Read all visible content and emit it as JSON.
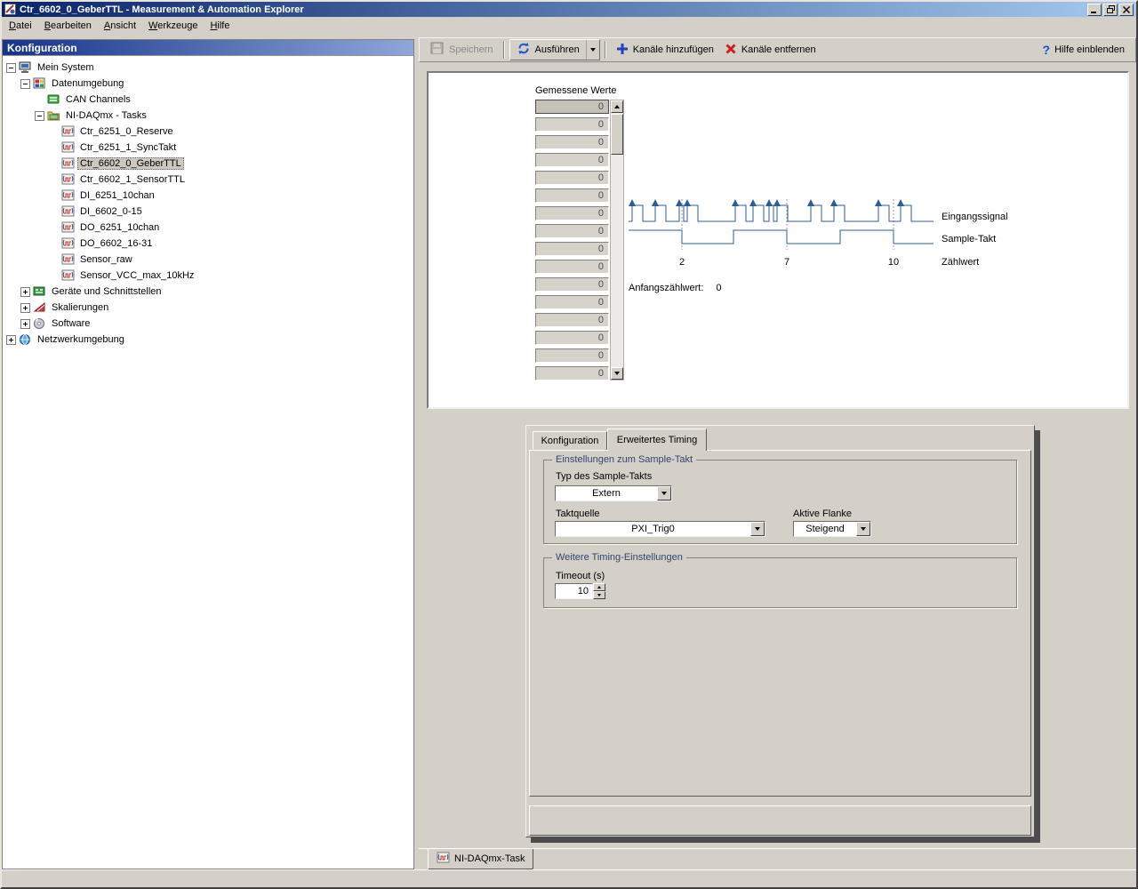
{
  "colors": {
    "titlebar_gradient_left": "#0a246a",
    "titlebar_gradient_right": "#a6caf0",
    "config_header_gradient_left": "#17338a",
    "waveform_blue": "#2d5d96",
    "group_label_blue": "#31456e"
  },
  "icons": {
    "help_glyph": "?"
  },
  "window": {
    "title": "Ctr_6602_0_GeberTTL - Measurement & Automation Explorer"
  },
  "menubar": {
    "items": [
      {
        "label": "Datei"
      },
      {
        "label": "Bearbeiten"
      },
      {
        "label": "Ansicht"
      },
      {
        "label": "Werkzeuge"
      },
      {
        "label": "Hilfe"
      }
    ]
  },
  "sidebar": {
    "header": "Konfiguration",
    "tree": [
      {
        "label": "Mein System"
      },
      {
        "label": "Datenumgebung"
      },
      {
        "label": "CAN Channels"
      },
      {
        "label": "NI-DAQmx - Tasks"
      },
      {
        "label": "Ctr_6251_0_Reserve"
      },
      {
        "label": "Ctr_6251_1_SyncTakt"
      },
      {
        "label": "Ctr_6602_0_GeberTTL"
      },
      {
        "label": "Ctr_6602_1_SensorTTL"
      },
      {
        "label": "DI_6251_10chan"
      },
      {
        "label": "DI_6602_0-15"
      },
      {
        "label": "DO_6251_10chan"
      },
      {
        "label": "DO_6602_16-31"
      },
      {
        "label": "Sensor_raw"
      },
      {
        "label": "Sensor_VCC_max_10kHz"
      },
      {
        "label": "Geräte und Schnittstellen"
      },
      {
        "label": "Skalierungen"
      },
      {
        "label": "Software"
      },
      {
        "label": "Netzwerkumgebung"
      }
    ]
  },
  "toolbar": {
    "save": "Speichern",
    "run": "Ausführen",
    "add_channels": "Kanäle hinzufügen",
    "remove_channels": "Kanäle entfernen",
    "help": "Hilfe einblenden"
  },
  "measured": {
    "title": "Gemessene Werte",
    "values": [
      "0",
      "0",
      "0",
      "0",
      "0",
      "0",
      "0",
      "0",
      "0",
      "0",
      "0",
      "0",
      "0",
      "0",
      "0",
      "0"
    ]
  },
  "diagram": {
    "signal_label": "Eingangssignal",
    "clock_label": "Sample-Takt",
    "count_label": "Zählwert",
    "ticks": [
      "2",
      "7",
      "10"
    ],
    "initial_label": "Anfangszählwert:",
    "initial_value": "0"
  },
  "tabs": {
    "configuration": "Konfiguration",
    "advanced_timing": "Erweitertes Timing"
  },
  "settings": {
    "sample_clock_group": "Einstellungen zum Sample-Takt",
    "sample_clock_type_label": "Typ des Sample-Takts",
    "sample_clock_type_value": "Extern",
    "clock_source_label": "Taktquelle",
    "clock_source_value": "PXI_Trig0",
    "active_edge_label": "Aktive Flanke",
    "active_edge_value": "Steigend",
    "timing_group": "Weitere Timing-Einstellungen",
    "timeout_label": "Timeout (s)",
    "timeout_value": "10"
  },
  "bottom_tab": {
    "label": "NI-DAQmx-Task"
  }
}
